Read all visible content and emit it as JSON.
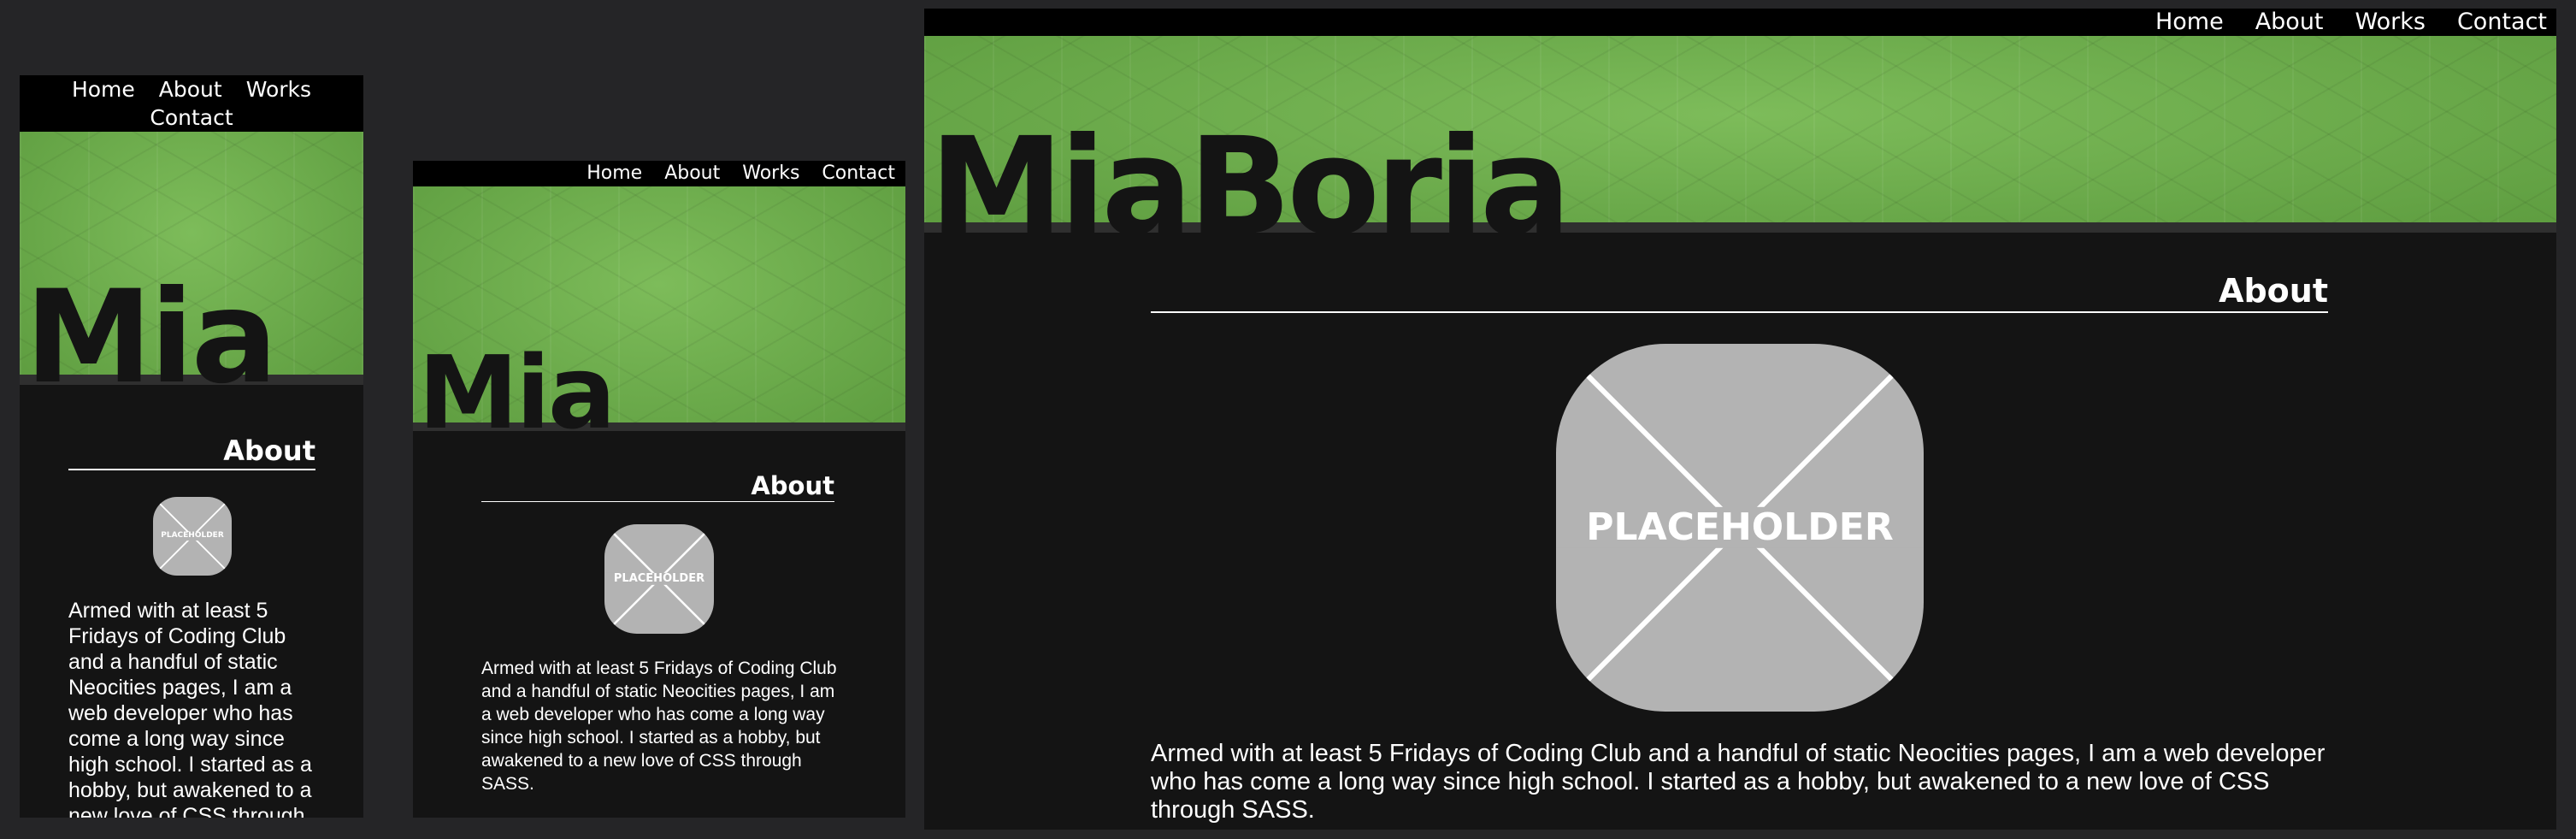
{
  "nav": {
    "items": [
      "Home",
      "About",
      "Works",
      "Contact"
    ]
  },
  "logo": {
    "short": "Mia",
    "full": "MiaBoria"
  },
  "section": {
    "heading": "About"
  },
  "placeholder": {
    "label": "PLACEHOLDER",
    "icon": "placeholder-image-icon"
  },
  "about": {
    "text": "Armed with at least 5 Fridays of Coding Club and a handful of static Neocities pages, I am a web developer who has come a long way since high school. I started as a hobby, but awakened to a new love of CSS through SASS."
  },
  "colors": {
    "page_bg": "#252527",
    "frame_bg": "#141414",
    "nav_bg": "#000000",
    "banner_green": "#6fad4f",
    "placeholder_gray": "#b3b3b3",
    "text": "#ffffff"
  }
}
